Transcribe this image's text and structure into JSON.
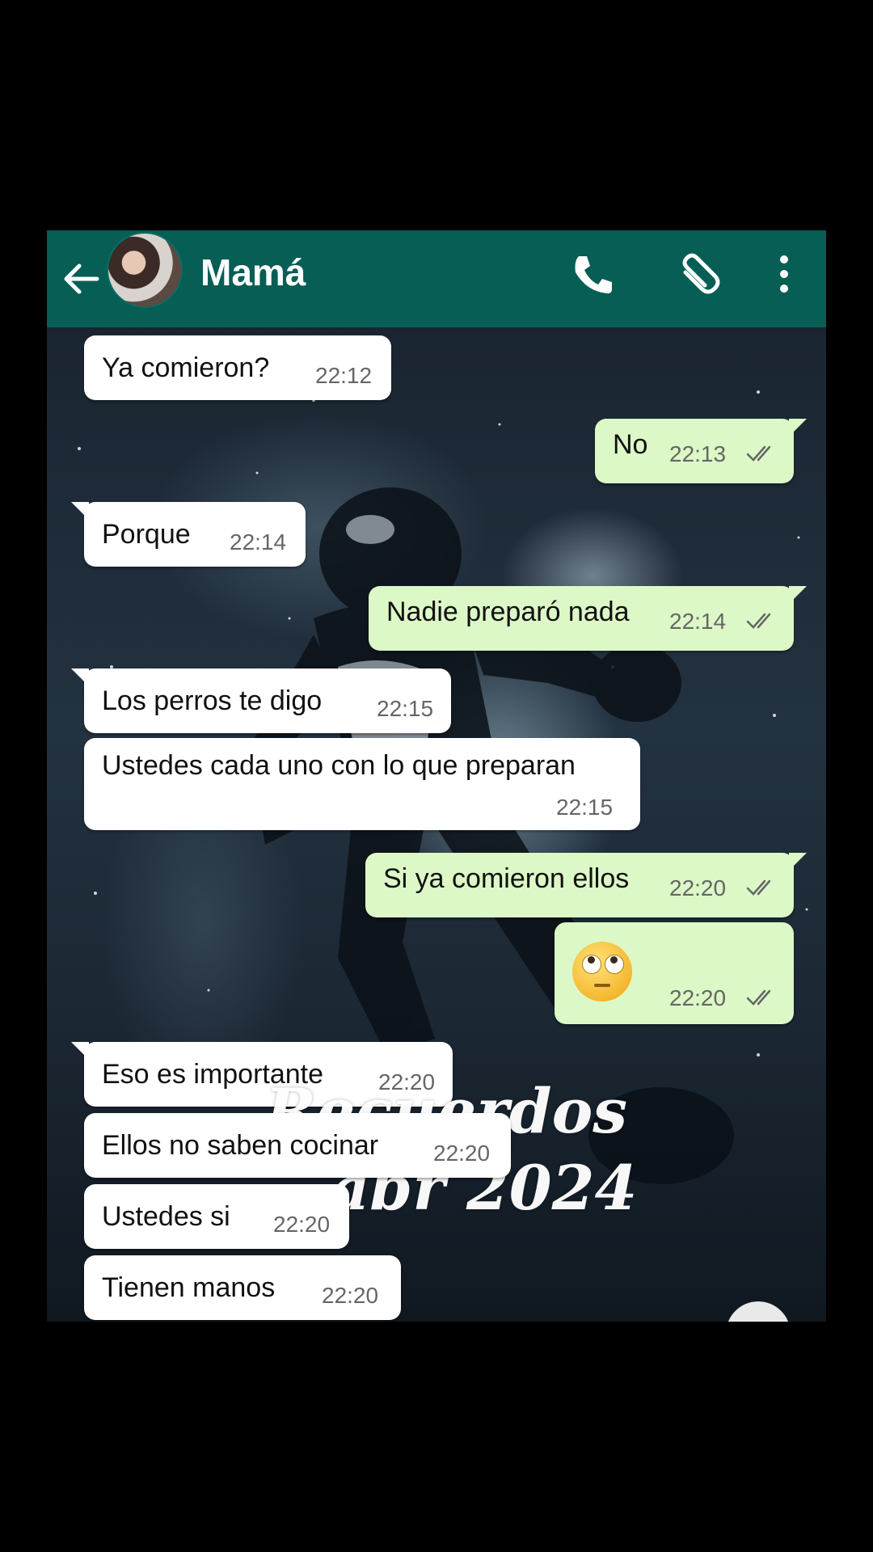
{
  "header": {
    "contact_name": "Mamá",
    "icons": [
      "back-arrow-icon",
      "call-icon",
      "attach-icon",
      "menu-icon"
    ],
    "background_color": "#075e54"
  },
  "messages": [
    {
      "direction": "in",
      "text": "Ya comieron?",
      "time": "22:12"
    },
    {
      "direction": "out",
      "text": "No",
      "time": "22:13",
      "status": "read"
    },
    {
      "direction": "in",
      "text": "Porque",
      "time": "22:14"
    },
    {
      "direction": "out",
      "text": "Nadie preparó nada",
      "time": "22:14",
      "status": "read"
    },
    {
      "direction": "in",
      "text": "Los perros te digo",
      "time": "22:15"
    },
    {
      "direction": "in",
      "text": "Ustedes cada uno con lo que preparan",
      "time": "22:15"
    },
    {
      "direction": "out",
      "text": "Si ya comieron ellos",
      "time": "22:20",
      "status": "read"
    },
    {
      "direction": "out",
      "text": "",
      "emoji": "face-with-rolling-eyes",
      "time": "22:20",
      "status": "read"
    },
    {
      "direction": "in",
      "text": "Eso es importante",
      "time": "22:20"
    },
    {
      "direction": "in",
      "text": "Ellos no saben cocinar",
      "time": "22:20"
    },
    {
      "direction": "in",
      "text": "Ustedes si",
      "time": "22:20"
    },
    {
      "direction": "in",
      "text": "Tienen manos",
      "time": "22:20"
    }
  ],
  "watermark": {
    "line1": "Recuerdos",
    "line2": "abr 2024"
  },
  "colors": {
    "incoming_bubble": "#ffffff",
    "outgoing_bubble": "#dcf8c6",
    "read_tick": "#666666"
  }
}
